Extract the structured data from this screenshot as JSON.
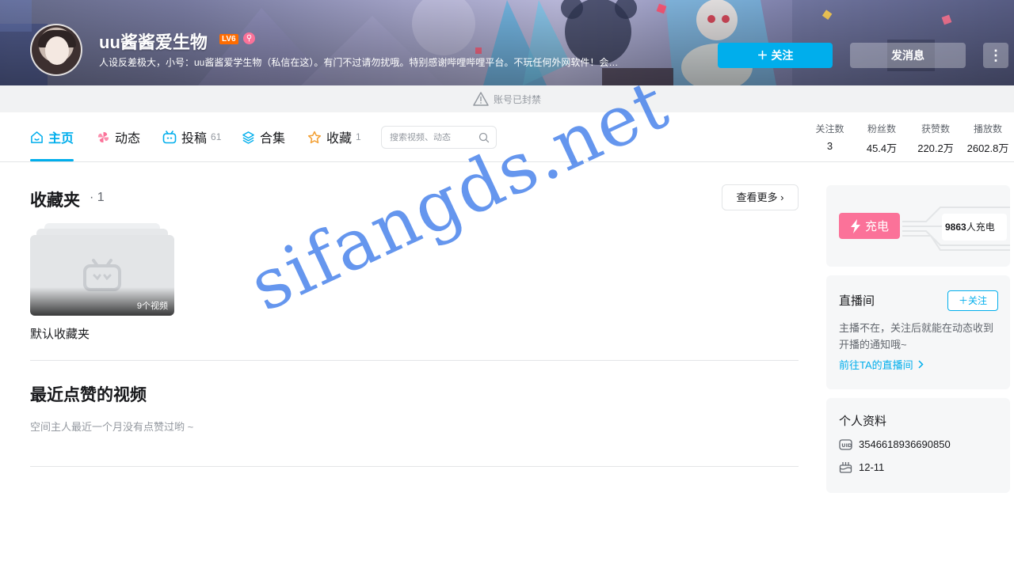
{
  "header": {
    "username": "uu酱酱爱生物",
    "level": "LV6",
    "vip_icon": "pin-icon",
    "sign": "人设反差极大，小号：uu酱酱爱学生物（私信在这）。有门不过请勿扰哦。特别感谢哔哩哔哩平台。不玩任何外网软件！会拉...",
    "follow_label": "＋ 关注",
    "message_label": "发消息",
    "more_label": "⋮"
  },
  "banned_notice": "账号已封禁",
  "nav": {
    "tabs": [
      {
        "label": "主页",
        "count": ""
      },
      {
        "label": "动态",
        "count": ""
      },
      {
        "label": "投稿",
        "count": "61"
      },
      {
        "label": "合集",
        "count": ""
      },
      {
        "label": "收藏",
        "count": "1"
      }
    ],
    "search_placeholder": "搜索视频、动态"
  },
  "stats": [
    {
      "label": "关注数",
      "value": "3"
    },
    {
      "label": "粉丝数",
      "value": "45.4万"
    },
    {
      "label": "获赞数",
      "value": "220.2万"
    },
    {
      "label": "播放数",
      "value": "2602.8万"
    }
  ],
  "favorites": {
    "title": "收藏夹",
    "count": "· 1",
    "see_more": "查看更多 ›",
    "folders": [
      {
        "name": "默认收藏夹",
        "video_count": "9个视频"
      }
    ]
  },
  "liked": {
    "title": "最近点赞的视频",
    "empty_tip": "空间主人最近一个月没有点赞过哟 ~"
  },
  "sidebar": {
    "charge": {
      "button": "充电",
      "count_num": "9863",
      "count_suffix": "人充电"
    },
    "live": {
      "title": "直播间",
      "follow": "＋关注",
      "desc": "主播不在，关注后就能在动态收到开播的通知哦~",
      "link": "前往TA的直播间"
    },
    "profile": {
      "title": "个人资料",
      "uid": "3546618936690850",
      "birthday": "12-11"
    }
  },
  "watermark": "sifangds.net",
  "colors": {
    "accent": "#00aeec",
    "pink": "#fb7299",
    "level": "#ff6c00"
  }
}
